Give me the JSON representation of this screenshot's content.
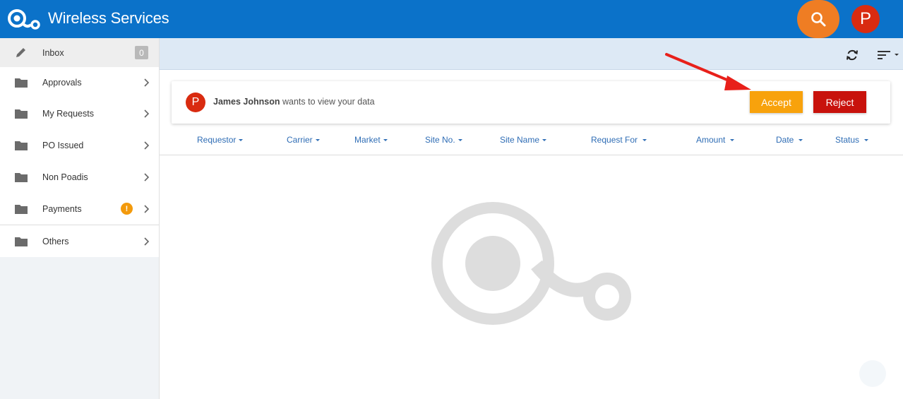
{
  "header": {
    "title": "Wireless Services",
    "user_initial": "P",
    "brand_color": "#0b72c9",
    "search_color": "#ef7d23"
  },
  "sidebar": {
    "items": [
      {
        "label": "Inbox",
        "icon": "pencil-icon",
        "count": "0"
      },
      {
        "label": "Approvals",
        "icon": "folder-icon"
      },
      {
        "label": "My Requests",
        "icon": "folder-icon"
      },
      {
        "label": "PO Issued",
        "icon": "folder-icon"
      },
      {
        "label": "Non Poadis",
        "icon": "folder-icon"
      },
      {
        "label": "Payments",
        "icon": "folder-icon",
        "alert": "!"
      },
      {
        "label": "Others",
        "icon": "folder-icon"
      }
    ]
  },
  "toolbar": {
    "refresh_icon": "refresh-icon",
    "sort_icon": "sort-icon"
  },
  "notification": {
    "initial": "P",
    "name": "James Johnson",
    "message": "wants to view your data",
    "accept_label": "Accept",
    "reject_label": "Reject",
    "accept_color": "#f8a20c",
    "reject_color": "#c8120c"
  },
  "table": {
    "columns": [
      "Requestor",
      "Carrier",
      "Market",
      "Site No.",
      "Site Name",
      "Request For",
      "Amount",
      "Date",
      "Status"
    ]
  }
}
